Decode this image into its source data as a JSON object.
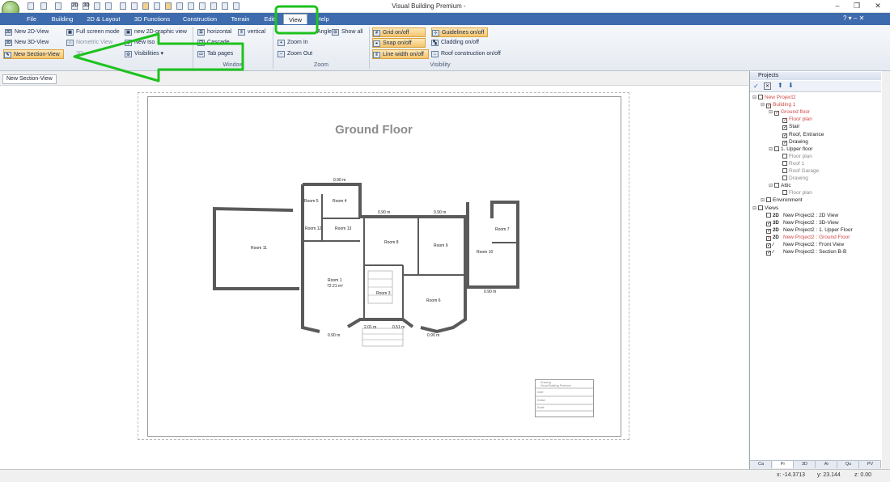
{
  "window": {
    "title": "Visual Building Premium -"
  },
  "quick_access": [
    "2D",
    "3D"
  ],
  "tabs": [
    "File",
    "Building",
    "2D & Layout",
    "3D Functions",
    "Construction",
    "Terrain",
    "Edit",
    "View",
    "Help"
  ],
  "ribbon": {
    "views": [
      "New 2D-View",
      "New 3D-View",
      "New Section-View"
    ],
    "views_b": [
      "Full screen mode",
      "Nometric View",
      "3D-"
    ],
    "views_c": [
      "new 2D-graphic view",
      "New Iso",
      "Visibilities"
    ],
    "window": {
      "horizontal": "horizontal",
      "vertical": "vertical",
      "cascade": "Cascade",
      "tab_pages": "Tab pages",
      "label": "Window"
    },
    "zoom": {
      "angle": "Angle",
      "show_all": "Show all",
      "zoom_in": "Zoom In",
      "zoom_out": "Zoom Out",
      "label": "Zoom"
    },
    "visibility": {
      "grid": "Grid on/off",
      "snap": "Snap on/off",
      "linewidth": "Line width on/off",
      "guidelines": "Guidelines on/off",
      "cladding": "Cladding on/off",
      "roof": "Roof construction on/off",
      "label": "Visibility"
    }
  },
  "command_button": "New Section-View",
  "plan": {
    "title": "Ground Floor",
    "rooms": [
      "Room 11",
      "Room 12",
      "Room 13",
      "Room 5",
      "Room 4",
      "Room 8",
      "Room 9",
      "Room 7",
      "Room 10",
      "Room 1",
      "Room 3",
      "Room 6"
    ],
    "room1_area": "72.21 m²",
    "dims": [
      "0.90 m",
      "0.90 m",
      "0.90 m",
      "0.90 m",
      "0.90 m",
      "0.90 m",
      "2.01 m",
      "0.51 m"
    ]
  },
  "titleblock": [
    "Drawing",
    "Visual Building Premium",
    "Date",
    "Drawn",
    "Scale"
  ],
  "panel": {
    "title": "Projects",
    "tree": [
      {
        "label": "New Project2",
        "level": 0,
        "style": "red",
        "check": false
      },
      {
        "label": "Building 1",
        "level": 1,
        "style": "red",
        "check": true
      },
      {
        "label": "Ground floor",
        "level": 2,
        "style": "red",
        "check": true
      },
      {
        "label": "Floor plan",
        "level": 3,
        "style": "red",
        "check": true
      },
      {
        "label": "Stair",
        "level": 3,
        "style": "",
        "check": true
      },
      {
        "label": "Roof, Entrance",
        "level": 3,
        "style": "",
        "check": true
      },
      {
        "label": "Drawing",
        "level": 3,
        "style": "",
        "check": true
      },
      {
        "label": "1. Upper floor",
        "level": 2,
        "style": "",
        "check": false
      },
      {
        "label": "Floor plan",
        "level": 3,
        "style": "gr",
        "check": false
      },
      {
        "label": "Roof 1",
        "level": 3,
        "style": "gr",
        "check": false
      },
      {
        "label": "Roof Garage",
        "level": 3,
        "style": "gr",
        "check": false
      },
      {
        "label": "Drawing",
        "level": 3,
        "style": "gr",
        "check": false
      },
      {
        "label": "Attic",
        "level": 2,
        "style": "",
        "check": false
      },
      {
        "label": "Floor plan",
        "level": 3,
        "style": "gr",
        "check": false
      },
      {
        "label": "Environment",
        "level": 1,
        "style": "",
        "check": false
      },
      {
        "label": "Views",
        "level": 0,
        "style": "",
        "check": false
      },
      {
        "label": "New Project2 : 2D View",
        "level": 1,
        "style": "",
        "view": "2D",
        "check": false
      },
      {
        "label": "New Project2 : 3D-View",
        "level": 1,
        "style": "",
        "view": "3D",
        "check": true
      },
      {
        "label": "New Project2 : 1. Upper Floor",
        "level": 1,
        "style": "",
        "view": "2D",
        "check": true
      },
      {
        "label": "New Project2 : Ground Floor",
        "level": 1,
        "style": "red",
        "view": "2D",
        "check": true
      },
      {
        "label": "New Project2 : Front View",
        "level": 1,
        "style": "",
        "view": "∕",
        "check": true
      },
      {
        "label": "New Project2 : Section B-B",
        "level": 1,
        "style": "",
        "view": "∕",
        "check": true
      }
    ],
    "bottom_tabs": [
      "Ca",
      "Pr",
      "3D",
      "Ar",
      "Qu",
      "PV"
    ]
  },
  "status": {
    "x": "x: -14.3713",
    "y": "y: 23.144",
    "z": "z: 0.00"
  },
  "colors": {
    "accent": "#3d6bad",
    "highlight": "#1ec21e",
    "wall": "#5a5a5a"
  }
}
